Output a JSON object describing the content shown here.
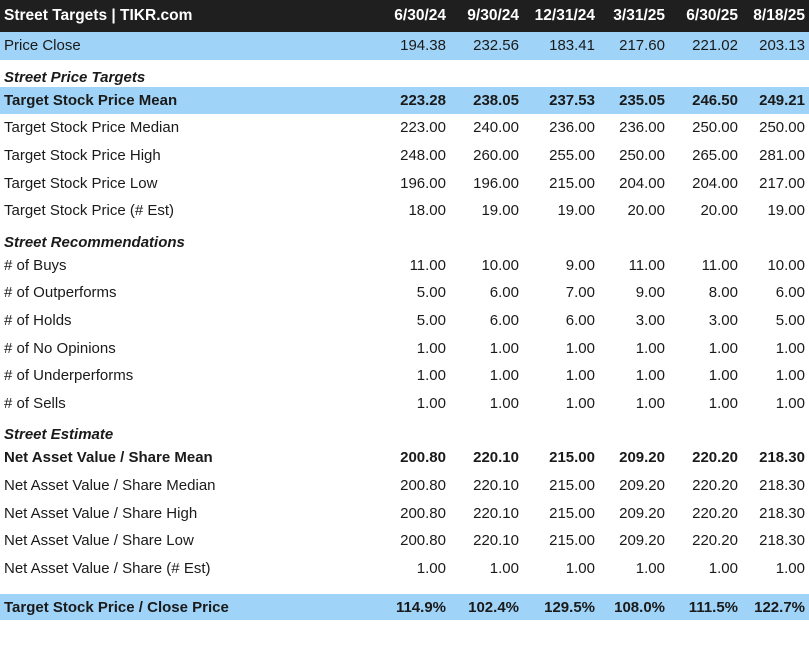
{
  "header": {
    "title": "Street Targets | TIKR.com",
    "columns": [
      "6/30/24",
      "9/30/24",
      "12/31/24",
      "3/31/25",
      "6/30/25",
      "8/18/25"
    ]
  },
  "price_close": {
    "label": "Price Close",
    "values": [
      "194.38",
      "232.56",
      "183.41",
      "217.60",
      "221.02",
      "203.13"
    ]
  },
  "price_targets": {
    "title": "Street Price Targets",
    "rows": [
      {
        "label": "Target Stock Price Mean",
        "values": [
          "223.28",
          "238.05",
          "237.53",
          "235.05",
          "246.50",
          "249.21"
        ]
      },
      {
        "label": "Target Stock Price Median",
        "values": [
          "223.00",
          "240.00",
          "236.00",
          "236.00",
          "250.00",
          "250.00"
        ]
      },
      {
        "label": "Target Stock Price High",
        "values": [
          "248.00",
          "260.00",
          "255.00",
          "250.00",
          "265.00",
          "281.00"
        ]
      },
      {
        "label": "Target Stock Price Low",
        "values": [
          "196.00",
          "196.00",
          "215.00",
          "204.00",
          "204.00",
          "217.00"
        ]
      },
      {
        "label": "Target Stock Price (# Est)",
        "values": [
          "18.00",
          "19.00",
          "19.00",
          "20.00",
          "20.00",
          "19.00"
        ]
      }
    ]
  },
  "recommendations": {
    "title": "Street Recommendations",
    "rows": [
      {
        "label": "# of Buys",
        "values": [
          "11.00",
          "10.00",
          "9.00",
          "11.00",
          "11.00",
          "10.00"
        ]
      },
      {
        "label": "# of Outperforms",
        "values": [
          "5.00",
          "6.00",
          "7.00",
          "9.00",
          "8.00",
          "6.00"
        ]
      },
      {
        "label": "# of Holds",
        "values": [
          "5.00",
          "6.00",
          "6.00",
          "3.00",
          "3.00",
          "5.00"
        ]
      },
      {
        "label": "# of No Opinions",
        "values": [
          "1.00",
          "1.00",
          "1.00",
          "1.00",
          "1.00",
          "1.00"
        ]
      },
      {
        "label": "# of Underperforms",
        "values": [
          "1.00",
          "1.00",
          "1.00",
          "1.00",
          "1.00",
          "1.00"
        ]
      },
      {
        "label": "# of Sells",
        "values": [
          "1.00",
          "1.00",
          "1.00",
          "1.00",
          "1.00",
          "1.00"
        ]
      }
    ]
  },
  "estimate": {
    "title": "Street Estimate",
    "rows": [
      {
        "label": "Net Asset Value / Share Mean",
        "values": [
          "200.80",
          "220.10",
          "215.00",
          "209.20",
          "220.20",
          "218.30"
        ]
      },
      {
        "label": "Net Asset Value / Share Median",
        "values": [
          "200.80",
          "220.10",
          "215.00",
          "209.20",
          "220.20",
          "218.30"
        ]
      },
      {
        "label": "Net Asset Value / Share High",
        "values": [
          "200.80",
          "220.10",
          "215.00",
          "209.20",
          "220.20",
          "218.30"
        ]
      },
      {
        "label": "Net Asset Value / Share Low",
        "values": [
          "200.80",
          "220.10",
          "215.00",
          "209.20",
          "220.20",
          "218.30"
        ]
      },
      {
        "label": "Net Asset Value / Share (# Est)",
        "values": [
          "1.00",
          "1.00",
          "1.00",
          "1.00",
          "1.00",
          "1.00"
        ]
      }
    ]
  },
  "ratio": {
    "label": "Target Stock Price / Close Price",
    "values": [
      "114.9%",
      "102.4%",
      "129.5%",
      "108.0%",
      "111.5%",
      "122.7%"
    ]
  },
  "colors": {
    "header_bg": "#1f1f1f",
    "highlight_bg": "#9fd3f7",
    "text": "#1a1a1a"
  }
}
